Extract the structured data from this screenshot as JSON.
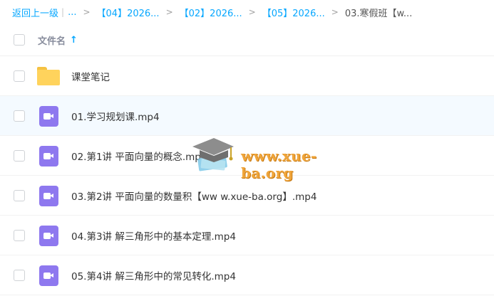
{
  "breadcrumb": {
    "back": "返回上一级",
    "divider": "|",
    "ellipsis": "...",
    "separator": ">",
    "items": [
      "【04】2026...",
      "【02】2026...",
      "【05】2026..."
    ],
    "current": "03.寒假班【w..."
  },
  "header": {
    "column_label": "文件名",
    "sort_icon": "arrow-up-icon",
    "sort_glyph": "↑"
  },
  "files": [
    {
      "name": "课堂笔记",
      "icon": "folder-icon"
    },
    {
      "name": "01.学习规划课.mp4",
      "icon": "video-file-icon"
    },
    {
      "name": "02.第1讲 平面向量的概念.mp4",
      "icon": "video-file-icon"
    },
    {
      "name": "03.第2讲 平面向量的数量积【ww w.xue-ba.org】.mp4",
      "icon": "video-file-icon"
    },
    {
      "name": "04.第3讲 解三角形中的基本定理.mp4",
      "icon": "video-file-icon"
    },
    {
      "name": "05.第4讲 解三角形中的常见转化.mp4",
      "icon": "video-file-icon"
    }
  ],
  "watermark": {
    "text": "www.xue-ba.org",
    "icon": "graduation-cap-logo"
  },
  "colors": {
    "accent": "#06a7ff",
    "folder": "#ffd35c",
    "video": "#8e78ef",
    "hover_row": "#f4faff",
    "watermark": "#f0a53a"
  }
}
